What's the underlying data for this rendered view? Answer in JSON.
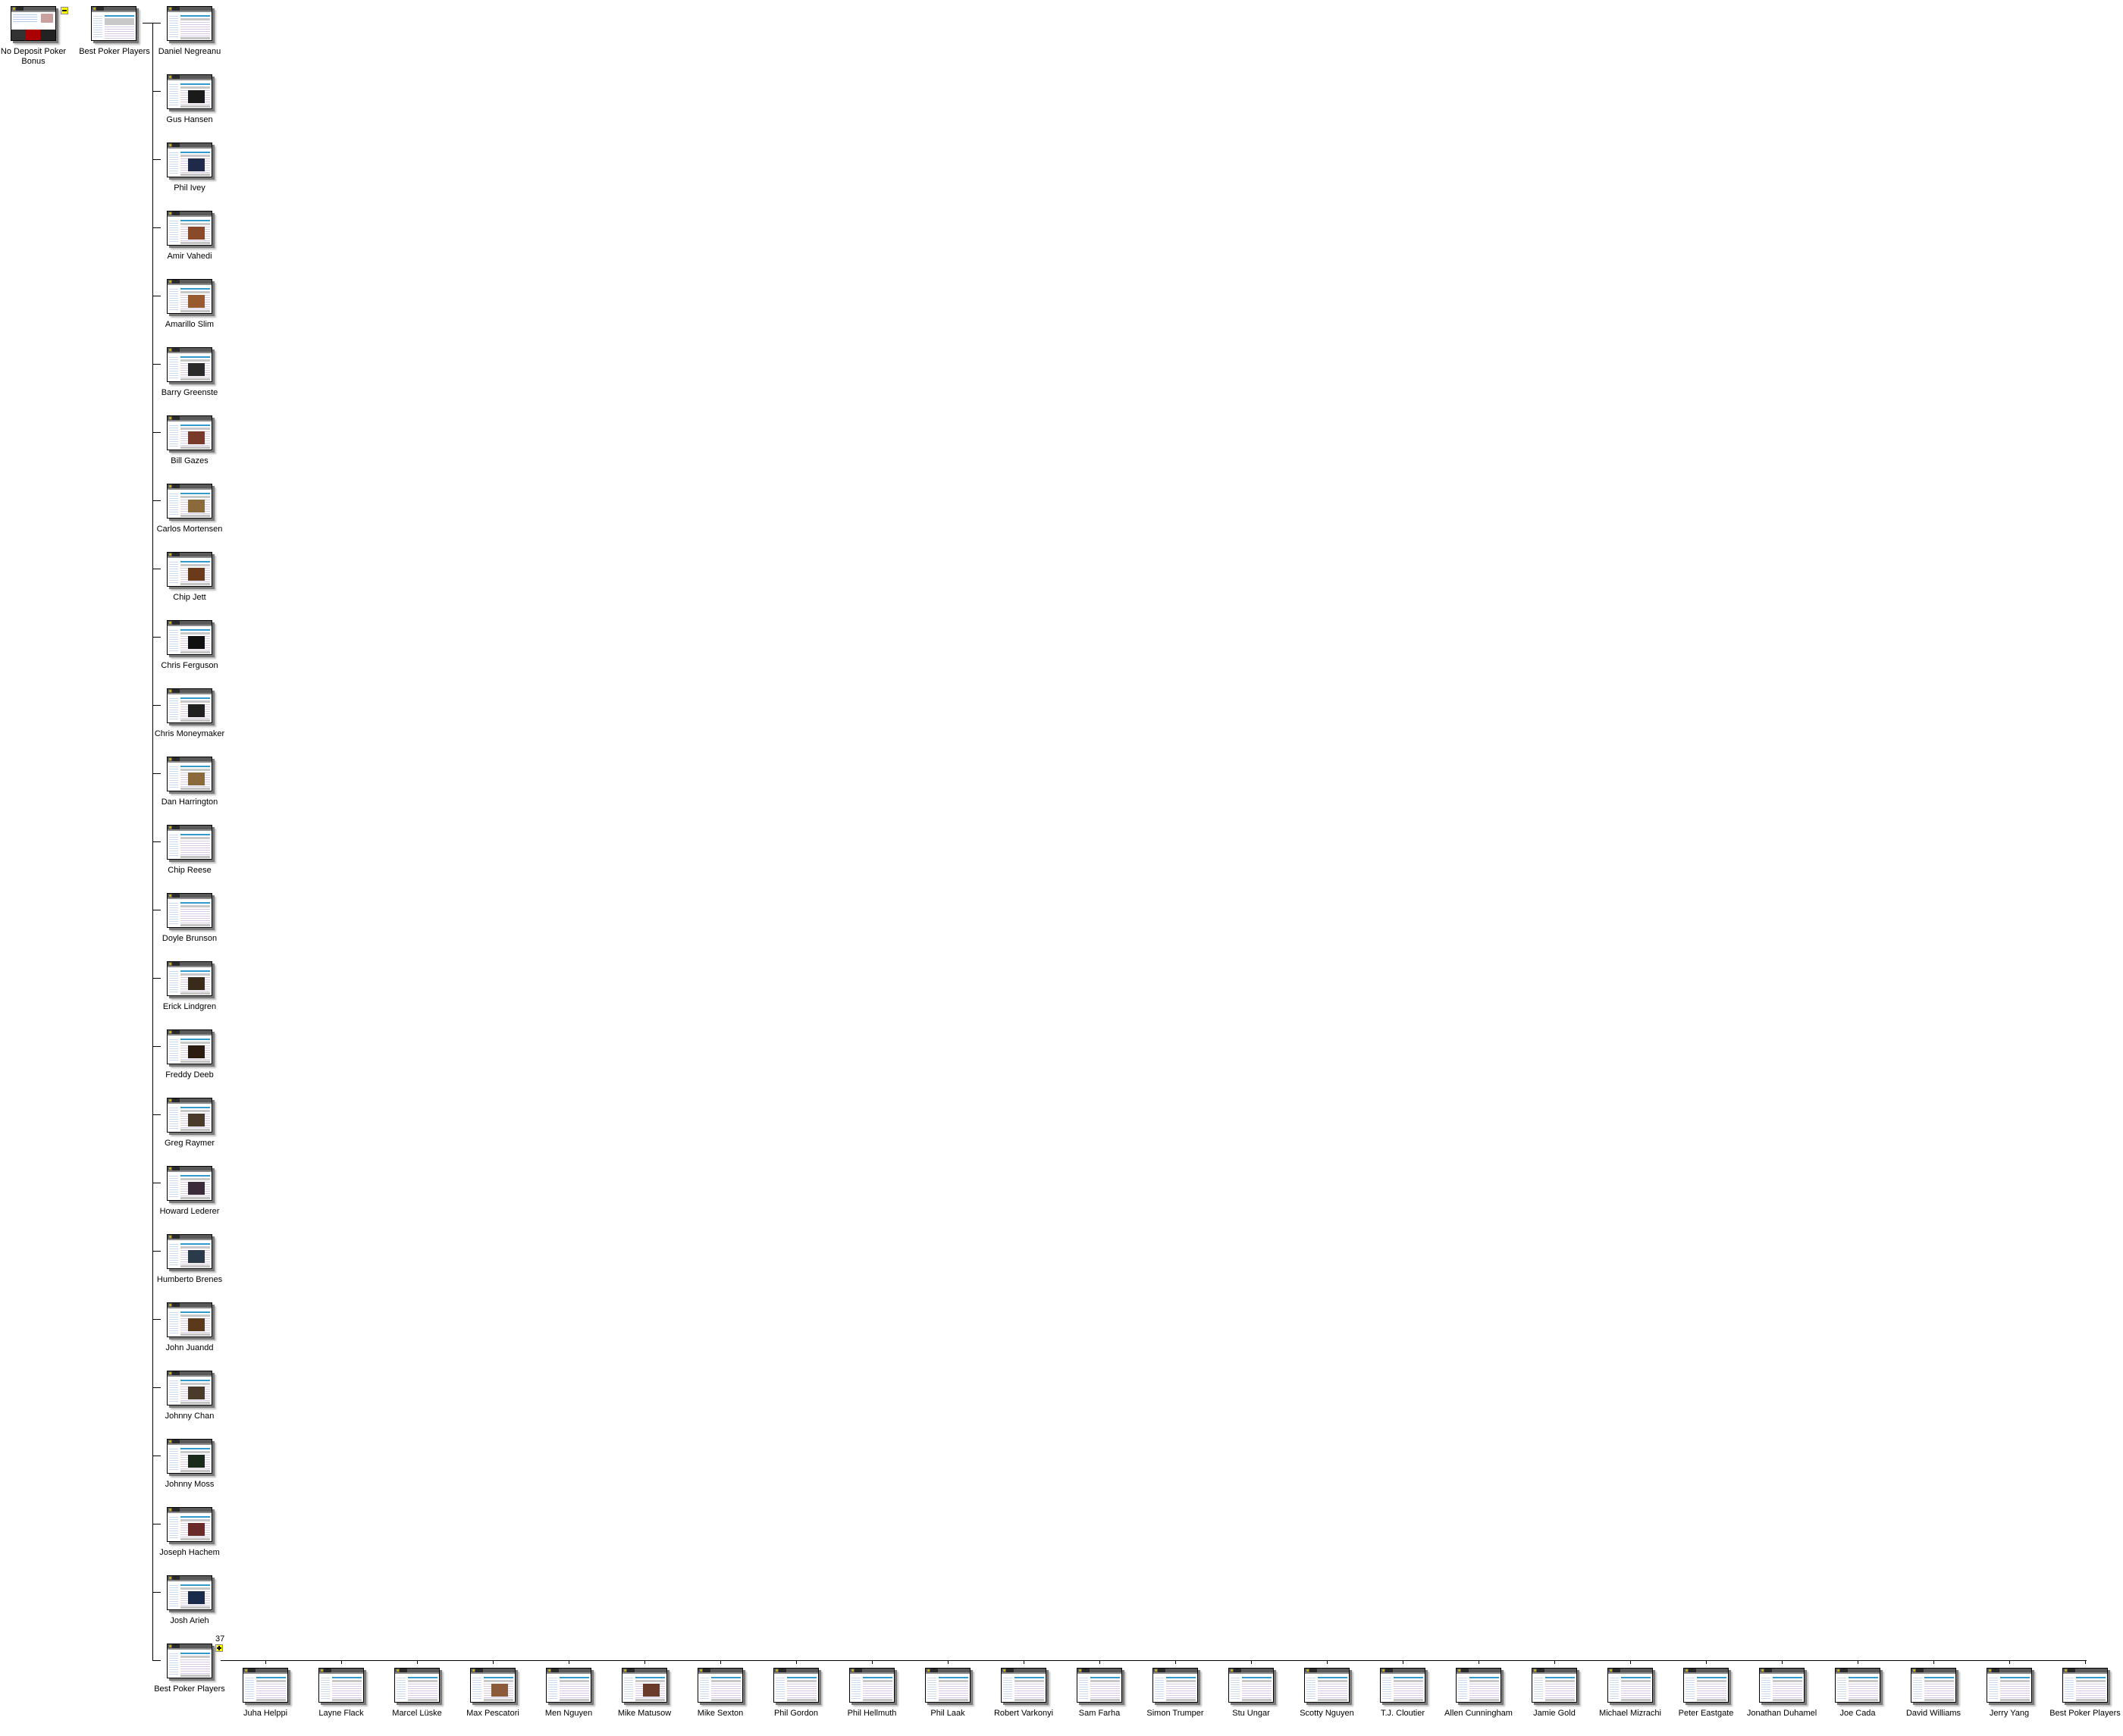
{
  "root": {
    "label": "No Deposit Poker Bonus",
    "collapse_marker": "minus"
  },
  "level1": {
    "label": "Best Poker Players"
  },
  "children": [
    {
      "label": "Daniel Negreanu",
      "photo": false
    },
    {
      "label": "Gus Hansen",
      "photo": true,
      "photo_color": "#1a1a1a"
    },
    {
      "label": "Phil Ivey",
      "photo": true,
      "photo_color": "#1f2a4a"
    },
    {
      "label": "Amir Vahedi",
      "photo": true,
      "photo_color": "#8a4a2a"
    },
    {
      "label": "Amarillo Slim",
      "photo": true,
      "photo_color": "#9a5a30"
    },
    {
      "label": "Barry Greenste",
      "photo": true,
      "photo_color": "#2a2a2a"
    },
    {
      "label": "Bill Gazes",
      "photo": true,
      "photo_color": "#7a3a2a"
    },
    {
      "label": "Carlos Mortensen",
      "photo": true,
      "photo_color": "#8a6a3a"
    },
    {
      "label": "Chip Jett",
      "photo": true,
      "photo_color": "#6a3a1a"
    },
    {
      "label": "Chris Ferguson",
      "photo": true,
      "photo_color": "#101010"
    },
    {
      "label": "Chris Moneymaker",
      "photo": true,
      "photo_color": "#202020"
    },
    {
      "label": "Dan Harrington",
      "photo": true,
      "photo_color": "#8a6a3a"
    },
    {
      "label": "Chip Reese",
      "photo": false
    },
    {
      "label": "Doyle Brunson",
      "photo": false
    },
    {
      "label": "Erick Lindgren",
      "photo": true,
      "photo_color": "#3a2a1a"
    },
    {
      "label": "Freddy Deeb",
      "photo": true,
      "photo_color": "#2a1a10"
    },
    {
      "label": "Greg Raymer",
      "photo": true,
      "photo_color": "#4a3a2a"
    },
    {
      "label": "Howard Lederer",
      "photo": true,
      "photo_color": "#3a2a3a"
    },
    {
      "label": "Humberto Brenes",
      "photo": true,
      "photo_color": "#2a3a4a"
    },
    {
      "label": "John Juandd",
      "photo": true,
      "photo_color": "#5a3a1a"
    },
    {
      "label": "Johnny Chan",
      "photo": true,
      "photo_color": "#4a3a2a"
    },
    {
      "label": "Johnny Moss",
      "photo": true,
      "photo_color": "#1a2a1a"
    },
    {
      "label": "Joseph Hachem",
      "photo": true,
      "photo_color": "#6a2a2a"
    },
    {
      "label": "Josh Arieh",
      "photo": true,
      "photo_color": "#1a2a4a"
    },
    {
      "label": "Best Poker Players",
      "photo": false,
      "count": "37",
      "expand_marker": "plus"
    }
  ],
  "grandchildren": [
    {
      "label": "Juha Helppi",
      "photo": false
    },
    {
      "label": "Layne Flack",
      "photo": false
    },
    {
      "label": "Marcel Lüske",
      "photo": false
    },
    {
      "label": "Max Pescatori",
      "photo": true,
      "photo_color": "#8a5a3a"
    },
    {
      "label": "Men Nguyen",
      "photo": false
    },
    {
      "label": "Mike Matusow",
      "photo": true,
      "photo_color": "#6a3a2a"
    },
    {
      "label": "Mike Sexton",
      "photo": false
    },
    {
      "label": "Phil Gordon",
      "photo": false
    },
    {
      "label": "Phil Hellmuth",
      "photo": false
    },
    {
      "label": "Phil Laak",
      "photo": false
    },
    {
      "label": "Robert Varkonyi",
      "photo": false
    },
    {
      "label": "Sam Farha",
      "photo": false
    },
    {
      "label": "Simon Trumper",
      "photo": false
    },
    {
      "label": "Stu Ungar",
      "photo": false
    },
    {
      "label": "Scotty Nguyen",
      "photo": false
    },
    {
      "label": "T.J. Cloutier",
      "photo": false
    },
    {
      "label": "Allen Cunningham",
      "photo": false
    },
    {
      "label": "Jamie Gold",
      "photo": false
    },
    {
      "label": "Michael Mizrachi",
      "photo": false
    },
    {
      "label": "Peter Eastgate",
      "photo": false
    },
    {
      "label": "Jonathan Duhamel",
      "photo": false
    },
    {
      "label": "Joe Cada",
      "photo": false
    },
    {
      "label": "David Williams",
      "photo": false
    },
    {
      "label": "Jerry Yang",
      "photo": false
    },
    {
      "label": "Best Poker Players",
      "photo": false
    }
  ],
  "colors": {
    "marker_fill": "#ffff00",
    "thumb_header": "#5a5a5a",
    "thumb_accent_bar": "#3399cc",
    "connector": "#000000"
  }
}
